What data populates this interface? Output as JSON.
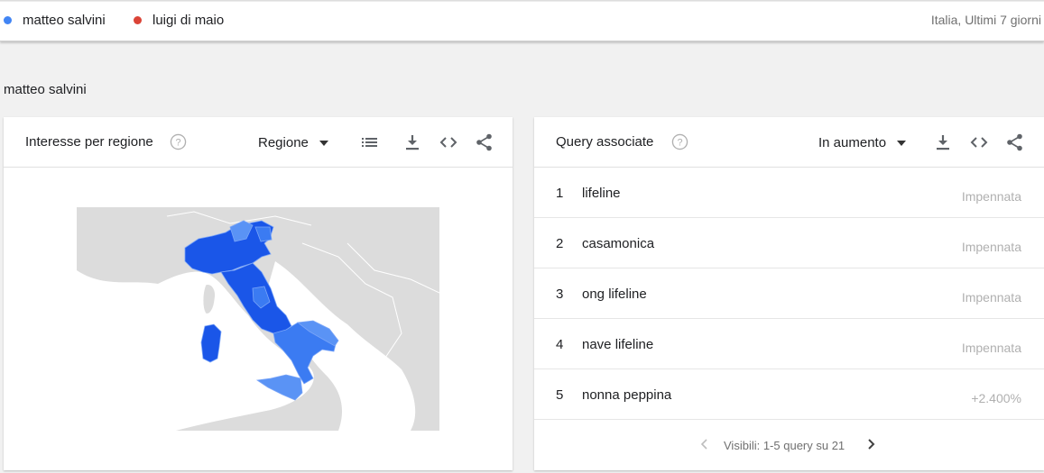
{
  "legend": {
    "terms": [
      {
        "label": "matteo salvini",
        "color": "#4285f4"
      },
      {
        "label": "luigi di maio",
        "color": "#db4437"
      }
    ],
    "scope": "Italia, Ultimi 7 giorni"
  },
  "section": {
    "title": "matteo salvini"
  },
  "region_card": {
    "title": "Interesse per regione",
    "help_icon": "help-circle-icon",
    "dropdown_value": "Regione",
    "tools": [
      "list-icon",
      "download-icon",
      "embed-icon",
      "share-icon"
    ],
    "map": {
      "country": "Italy",
      "fill_strong": "#1a56e8",
      "fill_mid": "#3b7bf2",
      "fill_light": "#5a93f5",
      "background": "#dcdcdc",
      "sea": "#ffffff"
    }
  },
  "query_card": {
    "title": "Query associate",
    "help_icon": "help-circle-icon",
    "dropdown_value": "In aumento",
    "tools": [
      "download-icon",
      "embed-icon",
      "share-icon"
    ],
    "rows": [
      {
        "rank": "1",
        "query": "lifeline",
        "value": "Impennata"
      },
      {
        "rank": "2",
        "query": "casamonica",
        "value": "Impennata"
      },
      {
        "rank": "3",
        "query": "ong lifeline",
        "value": "Impennata"
      },
      {
        "rank": "4",
        "query": "nave lifeline",
        "value": "Impennata"
      },
      {
        "rank": "5",
        "query": "nonna peppina",
        "value": "+2.400%"
      }
    ],
    "pager_text": "Visibili: 1-5 query su 21"
  }
}
